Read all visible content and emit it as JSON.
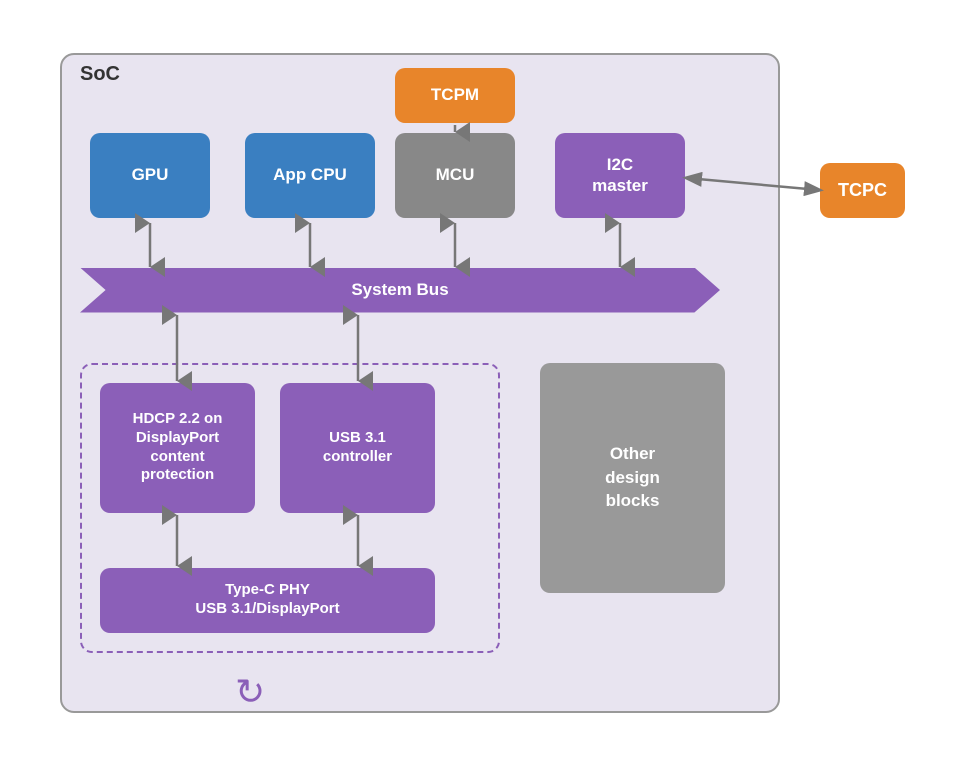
{
  "diagram": {
    "soc_label": "SoC",
    "blocks": {
      "gpu": "GPU",
      "app_cpu": "App CPU",
      "tcpm": "TCPM",
      "mcu": "MCU",
      "i2c_master": "I2C\nmaster",
      "tcpc": "TCPC",
      "system_bus": "System Bus",
      "hdcp": "HDCP 2.2 on\nDisplayPort\ncontent\nprotection",
      "usb31_ctrl": "USB 3.1\ncontroller",
      "typec_phy": "Type-C PHY\nUSB 3.1/DisplayPort",
      "other_blocks": "Other\ndesign\nblocks"
    },
    "colors": {
      "blue": "#3a7fc1",
      "gray": "#888888",
      "purple": "#8b5fb8",
      "orange": "#e8852a",
      "soc_bg": "#e8e4f0",
      "arrow": "#777777"
    }
  }
}
